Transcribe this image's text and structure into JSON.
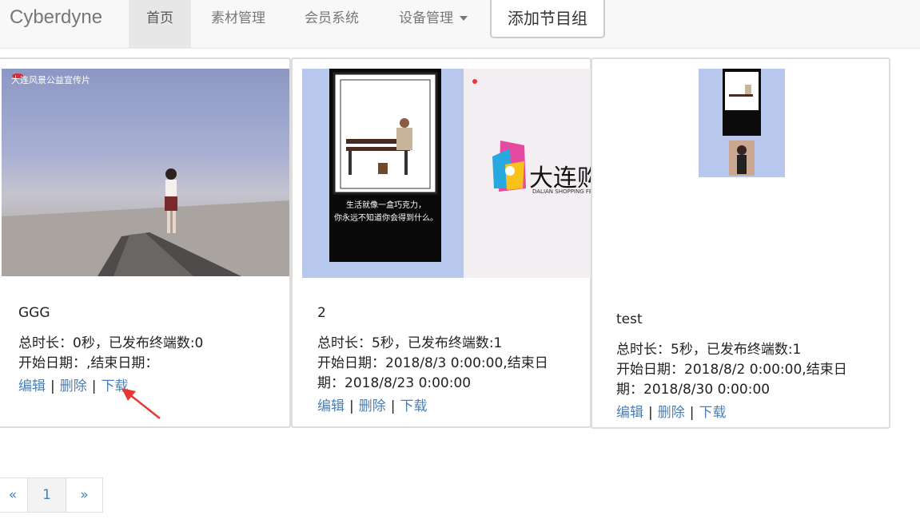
{
  "nav": {
    "brand": "Cyberdyne",
    "items": [
      {
        "label": "首页"
      },
      {
        "label": "素材管理"
      },
      {
        "label": "会员系统"
      },
      {
        "label": "设备管理"
      }
    ],
    "add_button": "添加节目组"
  },
  "cards": [
    {
      "title": "GGG",
      "duration_line": "总时长：0秒，已发布终端数:0",
      "date_line1": "开始日期：,结束日期：",
      "date_line2": "",
      "thumb_caption": "大连风景公益宣传片",
      "edit": "编辑",
      "delete": "删除",
      "download": "下载"
    },
    {
      "title": "2",
      "duration_line": "总时长：5秒，已发布终端数:1",
      "date_line1": "开始日期：2018/8/3 0:00:00,结束日",
      "date_line2": "期：2018/8/23 0:00:00",
      "thumb_logo": "大连购物",
      "thumb_sub": "DALIAN SHOPPING FES",
      "thumb_poster_line1": "生活就像一盒巧克力，",
      "thumb_poster_line2": "你永远不知道你会得到什么。",
      "edit": "编辑",
      "delete": "删除",
      "download": "下载"
    },
    {
      "title": "test",
      "duration_line": "总时长：5秒，已发布终端数:1",
      "date_line1": "开始日期：2018/8/2 0:00:00,结束日",
      "date_line2": "期：2018/8/30 0:00:00",
      "edit": "编辑",
      "delete": "删除",
      "download": "下载"
    }
  ],
  "pager": {
    "prev": "«",
    "page": "1",
    "next": "»"
  },
  "colors": {
    "link": "#4a7fb5",
    "arrow": "#e53935",
    "thumb_bg": "#b8c8ec"
  }
}
